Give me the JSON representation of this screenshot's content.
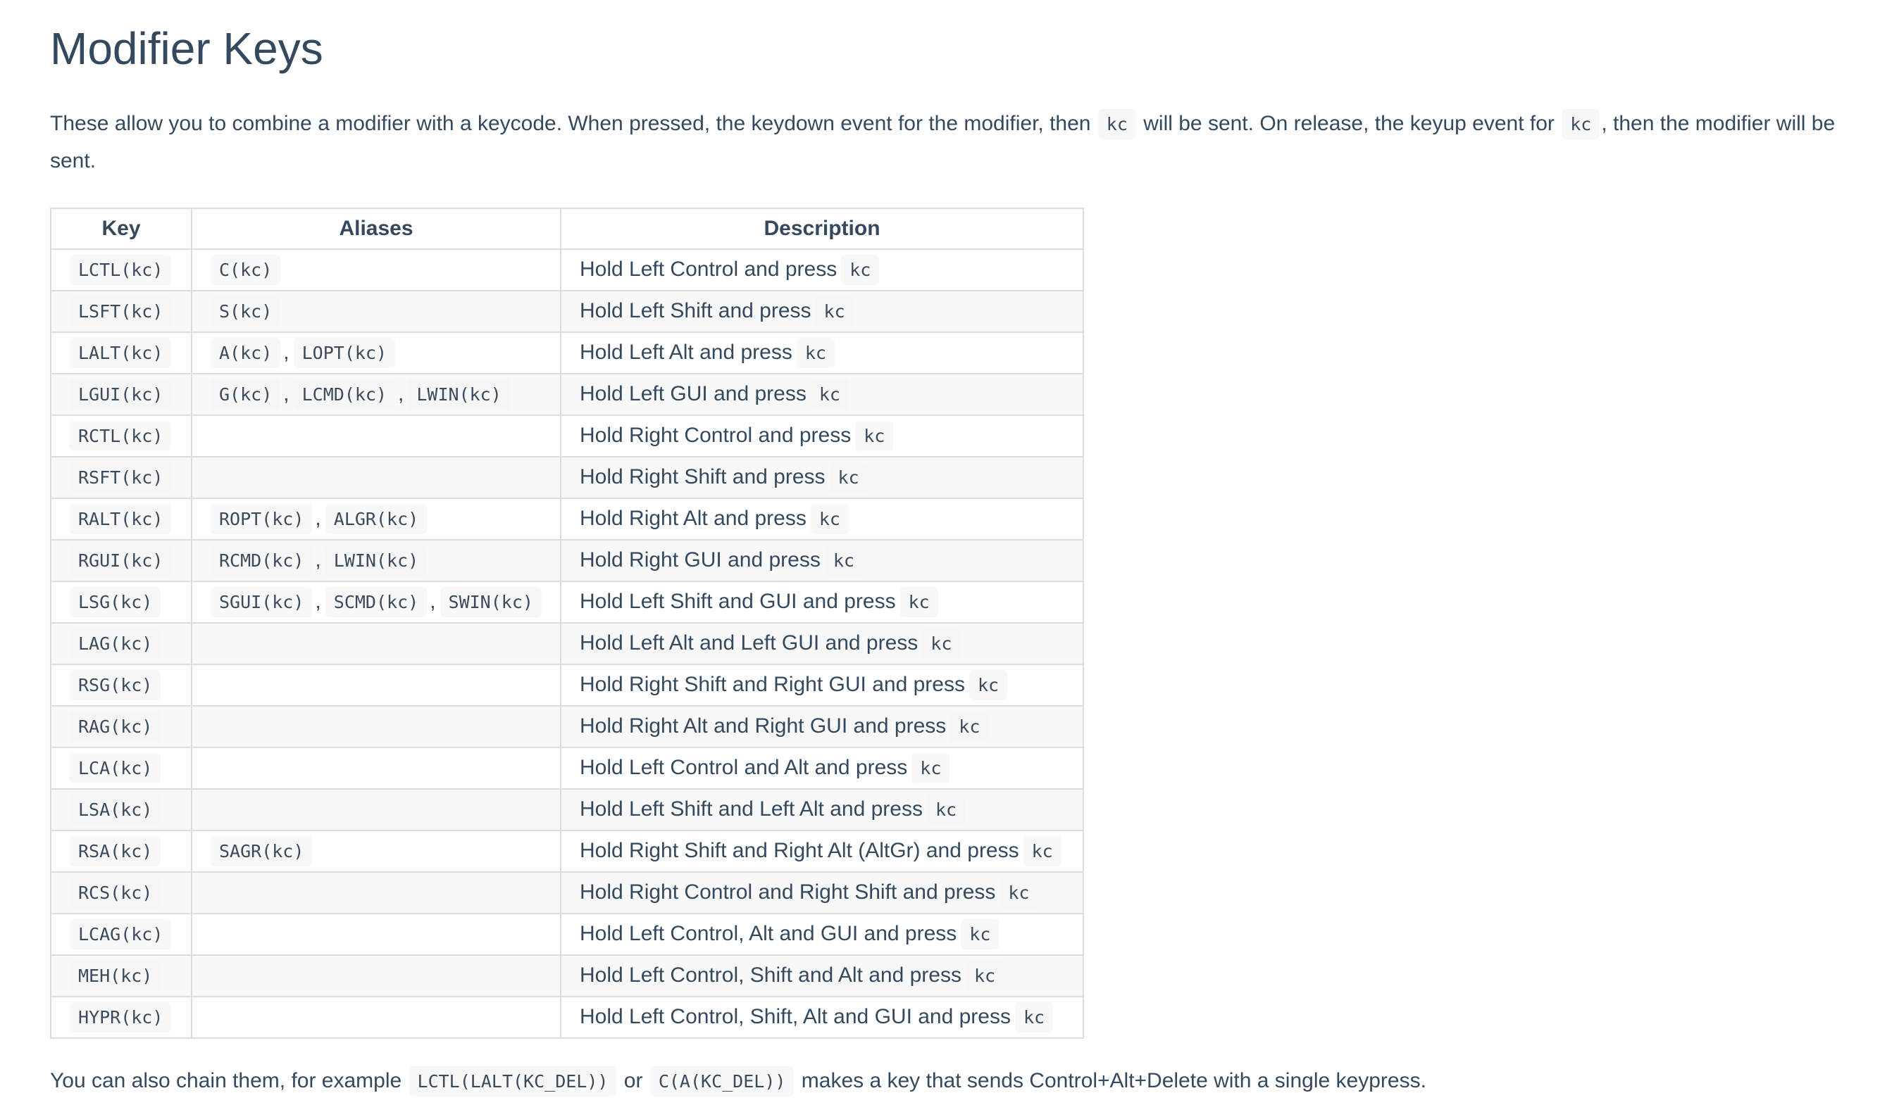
{
  "page": {
    "title": "Modifier Keys",
    "intro": {
      "parts": [
        {
          "t": "text",
          "v": "These allow you to combine a modifier with a keycode. When pressed, the keydown event for the modifier, then "
        },
        {
          "t": "code",
          "v": "kc"
        },
        {
          "t": "text",
          "v": " will be sent. On release, the keyup event for "
        },
        {
          "t": "code",
          "v": "kc"
        },
        {
          "t": "text",
          "v": ", then the modifier will be sent."
        }
      ]
    },
    "outro": {
      "parts": [
        {
          "t": "text",
          "v": "You can also chain them, for example "
        },
        {
          "t": "code",
          "v": "LCTL(LALT(KC_DEL))"
        },
        {
          "t": "text",
          "v": " or "
        },
        {
          "t": "code",
          "v": "C(A(KC_DEL))"
        },
        {
          "t": "text",
          "v": " makes a key that sends Control+Alt+Delete with a single keypress."
        }
      ]
    }
  },
  "table": {
    "headers": {
      "key": "Key",
      "aliases": "Aliases",
      "description": "Description"
    },
    "alias_separator": ",",
    "rows": [
      {
        "key": "LCTL(kc)",
        "aliases": [
          "C(kc)"
        ],
        "description": "Hold Left Control and press",
        "desc_code": "kc"
      },
      {
        "key": "LSFT(kc)",
        "aliases": [
          "S(kc)"
        ],
        "description": "Hold Left Shift and press",
        "desc_code": "kc"
      },
      {
        "key": "LALT(kc)",
        "aliases": [
          "A(kc)",
          "LOPT(kc)"
        ],
        "description": "Hold Left Alt and press",
        "desc_code": "kc"
      },
      {
        "key": "LGUI(kc)",
        "aliases": [
          "G(kc)",
          "LCMD(kc)",
          "LWIN(kc)"
        ],
        "description": "Hold Left GUI and press",
        "desc_code": "kc"
      },
      {
        "key": "RCTL(kc)",
        "aliases": [],
        "description": "Hold Right Control and press",
        "desc_code": "kc"
      },
      {
        "key": "RSFT(kc)",
        "aliases": [],
        "description": "Hold Right Shift and press",
        "desc_code": "kc"
      },
      {
        "key": "RALT(kc)",
        "aliases": [
          "ROPT(kc)",
          "ALGR(kc)"
        ],
        "description": "Hold Right Alt and press",
        "desc_code": "kc"
      },
      {
        "key": "RGUI(kc)",
        "aliases": [
          "RCMD(kc)",
          "LWIN(kc)"
        ],
        "description": "Hold Right GUI and press",
        "desc_code": "kc"
      },
      {
        "key": "LSG(kc)",
        "aliases": [
          "SGUI(kc)",
          "SCMD(kc)",
          "SWIN(kc)"
        ],
        "description": "Hold Left Shift and GUI and press",
        "desc_code": "kc"
      },
      {
        "key": "LAG(kc)",
        "aliases": [],
        "description": "Hold Left Alt and Left GUI and press",
        "desc_code": "kc"
      },
      {
        "key": "RSG(kc)",
        "aliases": [],
        "description": "Hold Right Shift and Right GUI and press",
        "desc_code": "kc"
      },
      {
        "key": "RAG(kc)",
        "aliases": [],
        "description": "Hold Right Alt and Right GUI and press",
        "desc_code": "kc"
      },
      {
        "key": "LCA(kc)",
        "aliases": [],
        "description": "Hold Left Control and Alt and press",
        "desc_code": "kc"
      },
      {
        "key": "LSA(kc)",
        "aliases": [],
        "description": "Hold Left Shift and Left Alt and press",
        "desc_code": "kc"
      },
      {
        "key": "RSA(kc)",
        "aliases": [
          "SAGR(kc)"
        ],
        "description": "Hold Right Shift and Right Alt (AltGr) and press",
        "desc_code": "kc"
      },
      {
        "key": "RCS(kc)",
        "aliases": [],
        "description": "Hold Right Control and Right Shift and press",
        "desc_code": "kc"
      },
      {
        "key": "LCAG(kc)",
        "aliases": [],
        "description": "Hold Left Control, Alt and GUI and press",
        "desc_code": "kc"
      },
      {
        "key": "MEH(kc)",
        "aliases": [],
        "description": "Hold Left Control, Shift and Alt and press",
        "desc_code": "kc"
      },
      {
        "key": "HYPR(kc)",
        "aliases": [],
        "description": "Hold Left Control, Shift, Alt and GUI and press",
        "desc_code": "kc"
      }
    ]
  },
  "colors": {
    "text": "#34495e",
    "code_background": "#f8f8f8",
    "table_border": "#dddddd",
    "row_stripe": "#f8f8f8"
  }
}
